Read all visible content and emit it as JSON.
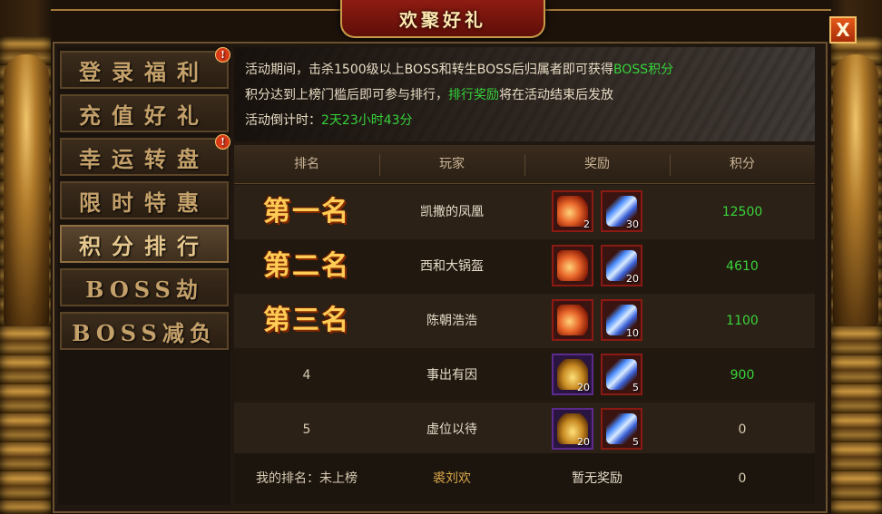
{
  "window": {
    "title": "欢聚好礼",
    "close_label": "X"
  },
  "sidebar": {
    "items": [
      {
        "label": "登录福利",
        "badge": "!"
      },
      {
        "label": "充值好礼",
        "badge": ""
      },
      {
        "label": "幸运转盘",
        "badge": "!"
      },
      {
        "label": "限时特惠",
        "badge": ""
      },
      {
        "label": "积分排行",
        "badge": "",
        "active": true
      },
      {
        "label": "BOSS劫",
        "badge": ""
      },
      {
        "label": "BOSS减负",
        "badge": ""
      }
    ]
  },
  "info": {
    "line1_prefix": "活动期间，击杀1500级以上BOSS和转生BOSS后归属者即可获得",
    "line1_highlight": "BOSS积分",
    "line2_prefix": "积分达到上榜门槛后即可参与排行，",
    "line2_highlight": "排行奖励",
    "line2_suffix": "将在活动结束后发放",
    "line3_prefix": "活动倒计时：",
    "line3_highlight": "2天23小时43分"
  },
  "table": {
    "headers": [
      "排名",
      "玩家",
      "奖励",
      "积分"
    ],
    "rows": [
      {
        "rank": "第一名",
        "player": "凯撒的凤凰",
        "rewards": [
          {
            "icon": "potion-icon",
            "count": "2"
          },
          {
            "icon": "crystal-icon",
            "count": "30"
          }
        ],
        "score": "12500"
      },
      {
        "rank": "第二名",
        "player": "西和大锅盔",
        "rewards": [
          {
            "icon": "potion-icon",
            "count": ""
          },
          {
            "icon": "crystal-icon",
            "count": "20"
          }
        ],
        "score": "4610"
      },
      {
        "rank": "第三名",
        "player": "陈朝浩浩",
        "rewards": [
          {
            "icon": "potion-icon",
            "count": ""
          },
          {
            "icon": "crystal-icon",
            "count": "10"
          }
        ],
        "score": "1100"
      },
      {
        "rank": "4",
        "player": "事出有因",
        "rewards": [
          {
            "icon": "chest-icon",
            "count": "20"
          },
          {
            "icon": "crystal-icon",
            "count": "5"
          }
        ],
        "score": "900"
      },
      {
        "rank": "5",
        "player": "虚位以待",
        "rewards": [
          {
            "icon": "chest-icon",
            "count": "20"
          },
          {
            "icon": "crystal-icon",
            "count": "5"
          }
        ],
        "score": "0"
      }
    ],
    "my_rank_label": "我的排名：未上榜",
    "my_name": "裘刘欢",
    "my_reward": "暂无奖励",
    "my_score": "0"
  },
  "colors": {
    "highlight_green": "#36d23a",
    "accent_gold": "#ffcc55",
    "title_red": "#8e1c12"
  }
}
